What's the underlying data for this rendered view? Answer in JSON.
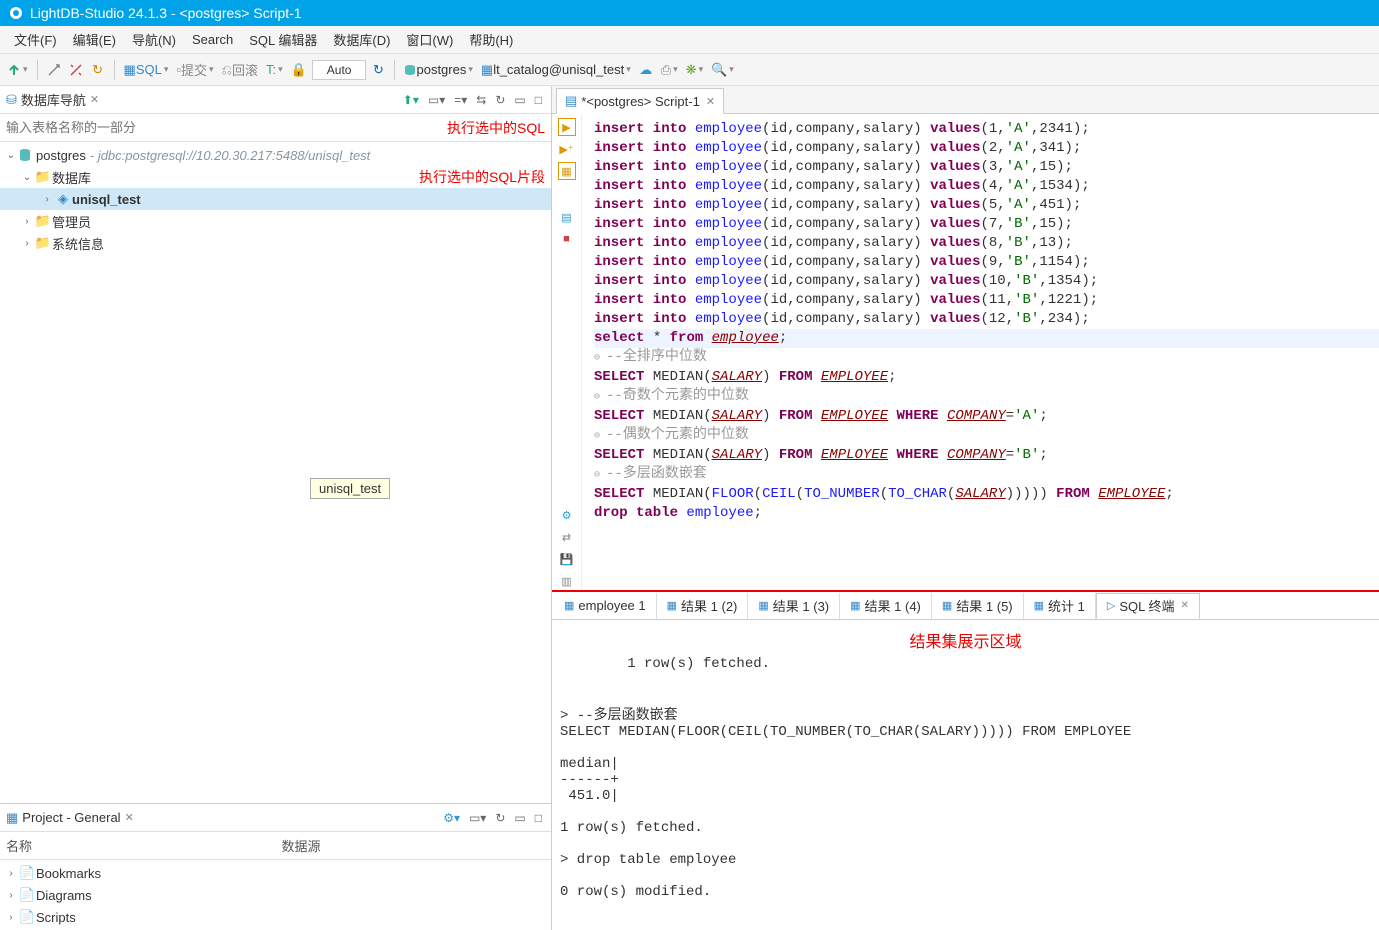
{
  "title": "LightDB-Studio 24.1.3 - <postgres> Script-1",
  "menu": [
    "文件(F)",
    "编辑(E)",
    "导航(N)",
    "Search",
    "SQL 编辑器",
    "数据库(D)",
    "窗口(W)",
    "帮助(H)"
  ],
  "toolbar": {
    "sql_label": "SQL",
    "commit_label": "提交",
    "rollback_label": "回滚",
    "auto_label": "Auto",
    "conn_label": "postgres",
    "catalog_label": "lt_catalog@unisql_test"
  },
  "nav_pane": {
    "title": "数据库导航",
    "filter_placeholder": "输入表格名称的一部分",
    "red1": "执行选中的SQL",
    "red2": "执行选中的SQL片段",
    "root": {
      "label": "postgres",
      "conn": "- jdbc:postgresql://10.20.30.217:5488/unisql_test"
    },
    "items": [
      {
        "label": "数据库",
        "children": [
          {
            "label": "unisql_test",
            "selected": true
          }
        ]
      },
      {
        "label": "管理员"
      },
      {
        "label": "系统信息"
      }
    ],
    "tooltip": "unisql_test"
  },
  "project_pane": {
    "title": "Project - General",
    "cols": [
      "名称",
      "数据源"
    ],
    "items": [
      "Bookmarks",
      "Diagrams",
      "Scripts"
    ]
  },
  "editor": {
    "tab_label": "*<postgres> Script-1",
    "sql_lines": [
      {
        "t": "insert",
        "args": "(1,'A',2341)"
      },
      {
        "t": "insert",
        "args": "(2,'A',341)"
      },
      {
        "t": "insert",
        "args": "(3,'A',15)"
      },
      {
        "t": "insert",
        "args": "(4,'A',1534)"
      },
      {
        "t": "insert",
        "args": "(5,'A',451)"
      },
      {
        "t": "insert",
        "args": "(7,'B',15)"
      },
      {
        "t": "insert",
        "args": "(8,'B',13)"
      },
      {
        "t": "insert",
        "args": "(9,'B',1154)"
      },
      {
        "t": "insert",
        "args": "(10,'B',1354)"
      },
      {
        "t": "insert",
        "args": "(11,'B',1221)"
      },
      {
        "t": "insert",
        "args": "(12,'B',234)"
      }
    ],
    "select_line": "select * from employee;",
    "comment1": "--全排序中位数",
    "median1": "SELECT MEDIAN(SALARY) FROM EMPLOYEE;",
    "comment2": "--奇数个元素的中位数",
    "median2": "SELECT MEDIAN(SALARY) FROM EMPLOYEE WHERE COMPANY='A';",
    "comment3": "--偶数个元素的中位数",
    "median3": "SELECT MEDIAN(SALARY) FROM EMPLOYEE WHERE COMPANY='B';",
    "comment4": "--多层函数嵌套",
    "median4": "SELECT MEDIAN(FLOOR(CEIL(TO_NUMBER(TO_CHAR(SALARY))))) FROM EMPLOYEE;",
    "drop_line": "drop table employee;"
  },
  "results": {
    "tabs": [
      "employee 1",
      "结果 1 (2)",
      "结果 1 (3)",
      "结果 1 (4)",
      "结果 1 (5)",
      "统计 1",
      "SQL 终端"
    ],
    "label": "结果集展示区域",
    "output": "1 row(s) fetched.\n\n\n> --多层函数嵌套\nSELECT MEDIAN(FLOOR(CEIL(TO_NUMBER(TO_CHAR(SALARY))))) FROM EMPLOYEE\n\nmedian|\n------+\n 451.0|\n\n1 row(s) fetched.\n\n> drop table employee\n\n0 row(s) modified."
  }
}
